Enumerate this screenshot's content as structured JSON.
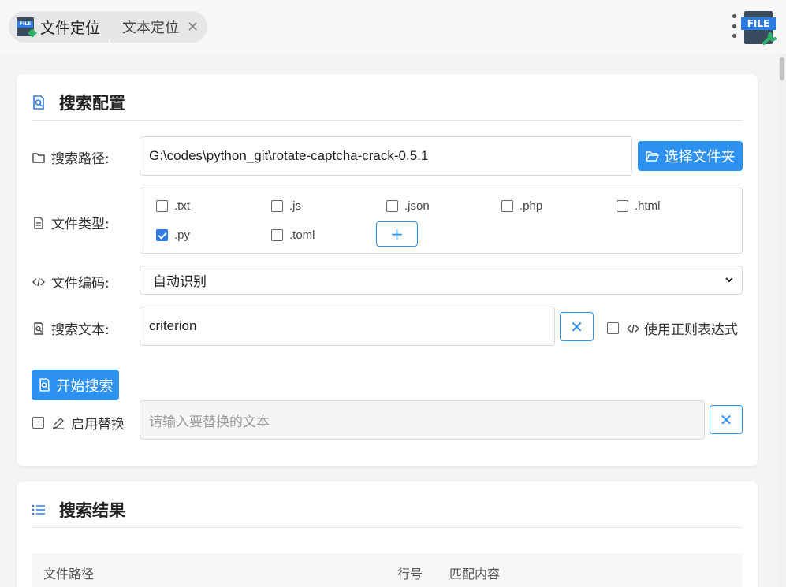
{
  "tabs": [
    {
      "label": "文件定位",
      "active": true
    },
    {
      "label": "文本定位",
      "active": false
    }
  ],
  "app_logo_text": "FILE",
  "config": {
    "title": "搜索配置",
    "path_label": "搜索路径:",
    "path_value": "G:\\codes\\python_git\\rotate-captcha-crack-0.5.1",
    "choose_folder": "选择文件夹",
    "types_label": "文件类型:",
    "file_types": [
      {
        "name": ".txt",
        "checked": false
      },
      {
        "name": ".js",
        "checked": false
      },
      {
        "name": ".json",
        "checked": false
      },
      {
        "name": ".php",
        "checked": false
      },
      {
        "name": ".html",
        "checked": false
      },
      {
        "name": ".py",
        "checked": true
      },
      {
        "name": ".toml",
        "checked": false
      }
    ],
    "add_type": "+",
    "encoding_label": "文件编码:",
    "encoding_value": "自动识别",
    "search_text_label": "搜索文本:",
    "search_text_value": "criterion",
    "clear_symbol": "✕",
    "regex_label": "使用正则表达式",
    "regex_checked": false,
    "start_search": "开始搜索",
    "replace_label": "启用替换",
    "replace_checked": false,
    "replace_placeholder": "请输入要替换的文本"
  },
  "results": {
    "title": "搜索结果",
    "columns": [
      "文件路径",
      "行号",
      "匹配内容"
    ]
  },
  "colors": {
    "accent": "#2d91f0",
    "icon_blue": "#2c7be5"
  }
}
